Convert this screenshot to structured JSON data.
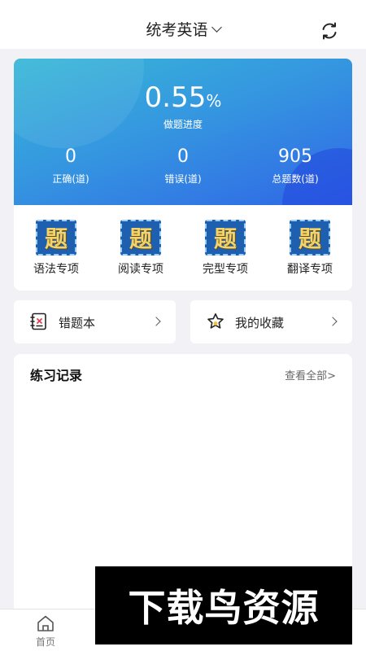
{
  "header": {
    "title": "统考英语"
  },
  "stats": {
    "progress_value": "0.55",
    "progress_unit": "%",
    "progress_label": "做题进度",
    "correct": {
      "value": "0",
      "label": "正确(道)"
    },
    "wrong": {
      "value": "0",
      "label": "错误(道)"
    },
    "total": {
      "value": "905",
      "label": "总题数(道)"
    }
  },
  "categories": [
    {
      "icon_text": "题",
      "label": "语法专项"
    },
    {
      "icon_text": "题",
      "label": "阅读专项"
    },
    {
      "icon_text": "题",
      "label": "完型专项"
    },
    {
      "icon_text": "题",
      "label": "翻译专项"
    }
  ],
  "quick_links": {
    "mistakes": "错题本",
    "favorites": "我的收藏"
  },
  "records": {
    "title": "练习记录",
    "view_all": "查看全部>"
  },
  "bottom_nav": {
    "home": "首页"
  },
  "watermark": "下载鸟资源",
  "colors": {
    "accent_gradient_start": "#36b7d6",
    "accent_gradient_end": "#2f66e6",
    "active_tab": "#e83f4f",
    "background": "#f2f2f6"
  }
}
